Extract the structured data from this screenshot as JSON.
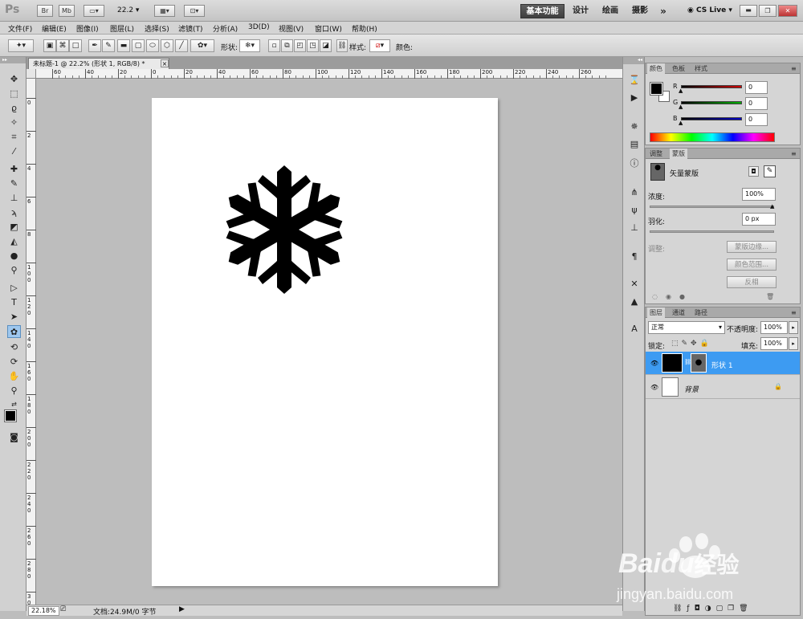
{
  "app": {
    "logo": "Ps",
    "header_icons": [
      "Br",
      "Mb"
    ],
    "zoom_select": "22.2",
    "workspaces": [
      "基本功能",
      "设计",
      "绘画",
      "摄影"
    ],
    "more": "»",
    "cslive": "CS Live",
    "cslive_arrow": "▾"
  },
  "menus": [
    "文件(F)",
    "编辑(E)",
    "图像(I)",
    "图层(L)",
    "选择(S)",
    "滤镜(T)",
    "分析(A)",
    "3D(D)",
    "视图(V)",
    "窗口(W)",
    "帮助(H)"
  ],
  "options_bar": {
    "shape_label": "形状:",
    "style_label": "样式:",
    "color_label": "颜色:",
    "color_value": "#000000"
  },
  "document": {
    "tab_title": "未标题-1 @ 22.2% (形状 1, RGB/8) *",
    "close": "×",
    "h_ruler_ticks": [
      "60",
      "40",
      "20",
      "0",
      "20",
      "40",
      "60",
      "80",
      "100",
      "120",
      "140",
      "160",
      "180",
      "200",
      "220",
      "240",
      "260"
    ],
    "v_ruler_ticks": [
      "0",
      "2",
      "4",
      "6",
      "8",
      "100",
      "120",
      "140",
      "160",
      "180",
      "200",
      "220",
      "240",
      "260",
      "280",
      "300"
    ],
    "shape_fill": "#000000"
  },
  "status": {
    "zoom": "22.18%",
    "doc_info": "文档:24.9M/0 字节"
  },
  "color_panel": {
    "tabs": [
      "颜色",
      "色板",
      "样式"
    ],
    "channels": [
      {
        "label": "R",
        "value": "0",
        "color": "#d00000"
      },
      {
        "label": "G",
        "value": "0",
        "color": "#00b000"
      },
      {
        "label": "B",
        "value": "0",
        "color": "#0000c8"
      }
    ]
  },
  "masks_panel": {
    "tabs": [
      "调整",
      "蒙版"
    ],
    "mask_type": "矢量蒙版",
    "density_label": "浓度:",
    "density_value": "100%",
    "feather_label": "羽化:",
    "feather_value": "0 px",
    "refine_label": "调整:",
    "buttons": [
      "蒙版边缘...",
      "颜色范围...",
      "反相"
    ]
  },
  "layers_panel": {
    "tabs": [
      "图层",
      "通道",
      "路径"
    ],
    "blend_mode": "正常",
    "opacity_label": "不透明度:",
    "opacity_value": "100%",
    "lock_label": "锁定:",
    "fill_label": "填充:",
    "fill_value": "100%",
    "layers": [
      {
        "name": "形状 1",
        "selected": true
      },
      {
        "name": "背景",
        "selected": false
      }
    ]
  },
  "watermark": {
    "brand_latin": "Bai",
    "brand_du": "du",
    "brand_cn": "经验",
    "url": "jingyan.baidu.com"
  },
  "colors": {
    "accent_selected": "#3d9bf2",
    "panel_bg": "#d5d5d5",
    "workspace_bg": "#bdbdbd"
  }
}
